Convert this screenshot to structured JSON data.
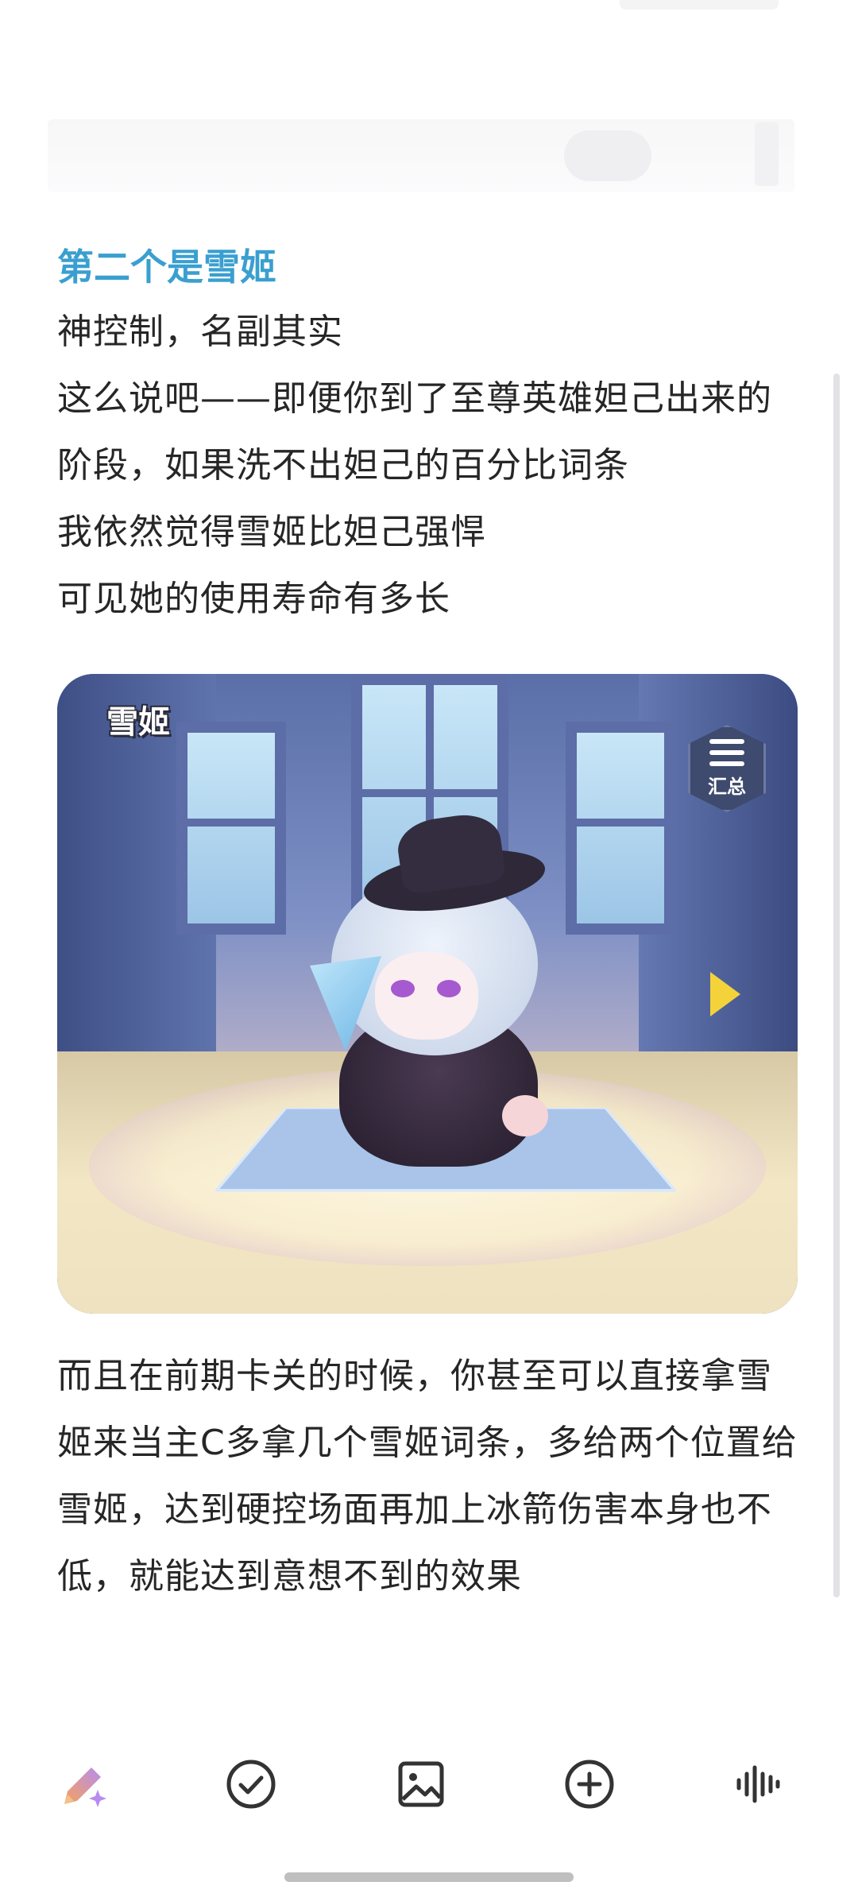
{
  "article": {
    "heading": "第二个是雪姬",
    "paragraphs": [
      "神控制，名副其实",
      "这么说吧——即便你到了至尊英雄妲己出来的阶段，如果洗不出妲己的百分比词条",
      "我依然觉得雪姬比妲己强悍",
      "可见她的使用寿命有多长"
    ],
    "image": {
      "character_label": "雪姬",
      "summary_label": "汇总"
    },
    "paragraphs_after": [
      "而且在前期卡关的时候，你甚至可以直接拿雪姬来当主C多拿几个雪姬词条，多给两个位置给雪姬，达到硬控场面再加上冰箭伤害本身也不低，就能达到意想不到的效果"
    ]
  },
  "toolbar": {
    "items": [
      {
        "icon": "ai-pen-icon"
      },
      {
        "icon": "check-circle-icon"
      },
      {
        "icon": "image-icon"
      },
      {
        "icon": "add-circle-icon"
      },
      {
        "icon": "voice-wave-icon"
      }
    ]
  },
  "colors": {
    "heading": "#3a9fd0",
    "body_text": "#262626",
    "icon": "#333333",
    "ai_pen_gradient": [
      "#f6a25a",
      "#b68cf0"
    ]
  }
}
